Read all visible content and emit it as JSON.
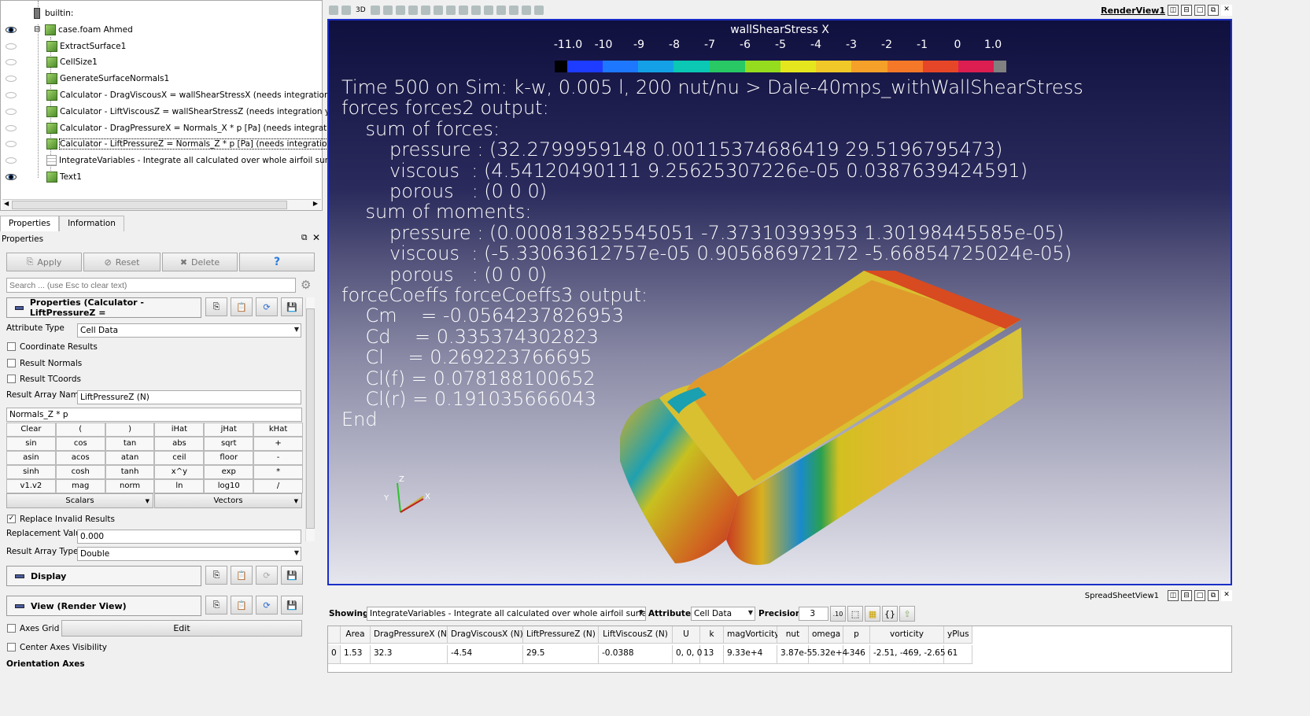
{
  "pipeline": {
    "items": [
      {
        "label": "builtin:",
        "icon": "server-icon",
        "visible": null
      },
      {
        "label": "case.foam Ahmed",
        "icon": "cube-icon",
        "visible": true
      },
      {
        "label": "ExtractSurface1",
        "icon": "cube-icon",
        "visible": false
      },
      {
        "label": "CellSize1",
        "icon": "cube-icon",
        "visible": false
      },
      {
        "label": "GenerateSurfaceNormals1",
        "icon": "cube-icon",
        "visible": false
      },
      {
        "label": "Calculator - DragViscousX = wallShearStressX (needs integration yet)",
        "icon": "cube-icon",
        "visible": false
      },
      {
        "label": "Calculator - LiftViscousZ = wallShearStressZ (needs integration yet)",
        "icon": "cube-icon",
        "visible": false
      },
      {
        "label": "Calculator - DragPressureX = Normals_X * p [Pa] (needs integration yet)",
        "icon": "cube-icon",
        "visible": false
      },
      {
        "label": "Calculator - LiftPressureZ = Normals_Z * p [Pa] (needs integration yet)",
        "icon": "cube-icon",
        "visible": false,
        "selected": true
      },
      {
        "label": "IntegrateVariables - Integrate all calculated over whole airfoil surface",
        "icon": "table-icon",
        "visible": false
      },
      {
        "label": "Text1",
        "icon": "cube-icon",
        "visible": true
      }
    ]
  },
  "tabs": [
    "Properties",
    "Information"
  ],
  "properties": {
    "title": "Properties",
    "apply": "Apply",
    "reset": "Reset",
    "delete": "Delete",
    "help": "?",
    "search_placeholder": "Search ... (use Esc to clear text)",
    "section_properties": "Properties (Calculator - LiftPressureZ =",
    "attribute_type_label": "Attribute Type",
    "attribute_type": "Cell Data",
    "coordinate_results": "Coordinate Results",
    "result_normals": "Result Normals",
    "result_tcoords": "Result TCoords",
    "result_array_name_label": "Result Array Name",
    "result_array_name": "LiftPressureZ (N)",
    "expression": "Normals_Z * p",
    "calc_buttons": [
      "Clear",
      "(",
      ")",
      "iHat",
      "jHat",
      "kHat",
      "sin",
      "cos",
      "tan",
      "abs",
      "sqrt",
      "+",
      "asin",
      "acos",
      "atan",
      "ceil",
      "floor",
      "-",
      "sinh",
      "cosh",
      "tanh",
      "x^y",
      "exp",
      "*",
      "v1.v2",
      "mag",
      "norm",
      "ln",
      "log10",
      "/"
    ],
    "scalars": "Scalars",
    "vectors": "Vectors",
    "replace_invalid": "Replace Invalid Results",
    "replacement_value_label": "Replacement Value",
    "replacement_value": "0.000",
    "result_array_type_label": "Result Array Type",
    "result_array_type": "Double",
    "section_display": "Display",
    "section_view": "View (Render View)",
    "axes_grid": "Axes Grid",
    "edit": "Edit",
    "center_axes": "Center Axes Visibility",
    "orientation_axes": "Orientation Axes"
  },
  "render": {
    "title": "RenderView1",
    "toolbar_3d": "3D",
    "colorbar": {
      "title": "wallShearStress X",
      "ticks": [
        "-11.0",
        "-10",
        "-9",
        "-8",
        "-7",
        "-6",
        "-5",
        "-4",
        "-3",
        "-2",
        "-1",
        "0",
        "1.0"
      ],
      "colors": [
        "#000000",
        "#1e3cff",
        "#1e78ff",
        "#14a0e6",
        "#0ac8b4",
        "#28c864",
        "#96dc1e",
        "#e6e61e",
        "#f0c828",
        "#f5a028",
        "#f57828",
        "#e64628",
        "#dc1e50",
        "#808080"
      ]
    },
    "overlay": [
      "Time 500 on Sim: k-w, 0.005 l, 200 nut/nu > Dale-40mps_withWallShearStress",
      "forces forces2 output:",
      "    sum of forces:",
      "        pressure : (32.2799959148 0.00115374686419 29.5196795473)",
      "        viscous  : (4.54120490111 9.25625307226e-05 0.0387639424591)",
      "        porous   : (0 0 0)",
      "    sum of moments:",
      "        pressure : (0.000813825545051 -7.37310393953 1.30198445585e-05)",
      "        viscous  : (-5.33063612757e-05 0.905686972172 -5.66854725024e-05)",
      "        porous   : (0 0 0)",
      "forceCoeffs forceCoeffs3 output:",
      "    Cm    = -0.0564237826953",
      "    Cd    = 0.335374302823",
      "    Cl    = 0.269223766695",
      "    Cl(f) = 0.078188100652",
      "    Cl(r) = 0.191035666043",
      "End"
    ],
    "axes": {
      "x": "X",
      "y": "Y",
      "z": "Z"
    }
  },
  "spreadsheet": {
    "title": "SpreadSheetView1",
    "showing_label": "Showing",
    "showing": "IntegrateVariables - Integrate all calculated over whole airfoil surface",
    "attribute_label": "Attribute:",
    "attribute": "Cell Data",
    "precision_label": "Precision:",
    "precision": "3",
    "fixed_label": ".10",
    "columns": [
      "",
      "Area",
      "DragPressureX (N)",
      "DragViscousX (N)",
      "LiftPressureZ (N)",
      "LiftViscousZ (N)",
      "U",
      "k",
      "magVorticity",
      "nut",
      "omega",
      "p",
      "vorticity",
      "yPlus"
    ],
    "rows": [
      [
        "0",
        "1.53",
        "32.3",
        "-4.54",
        "29.5",
        "-0.0388",
        "0, 0, 0",
        "13",
        "9.33e+4",
        "3.87e-5",
        "5.32e+4",
        "-346",
        "-2.51, -469, -2.65",
        "61"
      ]
    ]
  }
}
